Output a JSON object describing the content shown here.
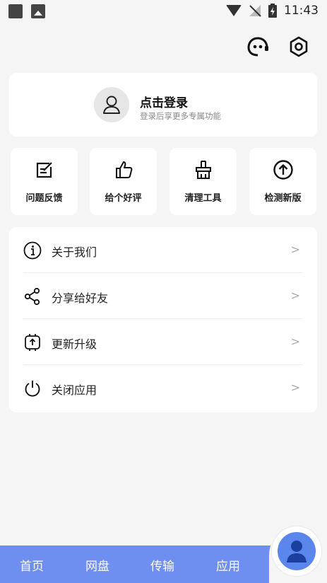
{
  "status_bar": {
    "time": "11:43"
  },
  "top_actions": {
    "icons": [
      "robot-icon",
      "settings-icon"
    ]
  },
  "login": {
    "title": "点击登录",
    "subtitle": "登录后享更多专属功能"
  },
  "quick_actions": [
    {
      "label": "问题反馈",
      "icon": "feedback-icon"
    },
    {
      "label": "给个好评",
      "icon": "thumbs-up-icon"
    },
    {
      "label": "清理工具",
      "icon": "broom-icon"
    },
    {
      "label": "检测新版",
      "icon": "arrow-up-circle-icon"
    }
  ],
  "menu": [
    {
      "label": "关于我们",
      "icon": "info-icon",
      "chevron": ">"
    },
    {
      "label": "分享给好友",
      "icon": "share-icon",
      "chevron": ">"
    },
    {
      "label": "更新升级",
      "icon": "update-icon",
      "chevron": ">"
    },
    {
      "label": "关闭应用",
      "icon": "power-icon",
      "chevron": ">"
    }
  ],
  "tabbar": {
    "tabs": [
      "首页",
      "网盘",
      "传输",
      "应用"
    ],
    "active_icon": "user-icon",
    "color": "#6f8ff0",
    "fab_color": "#5b87ec"
  }
}
